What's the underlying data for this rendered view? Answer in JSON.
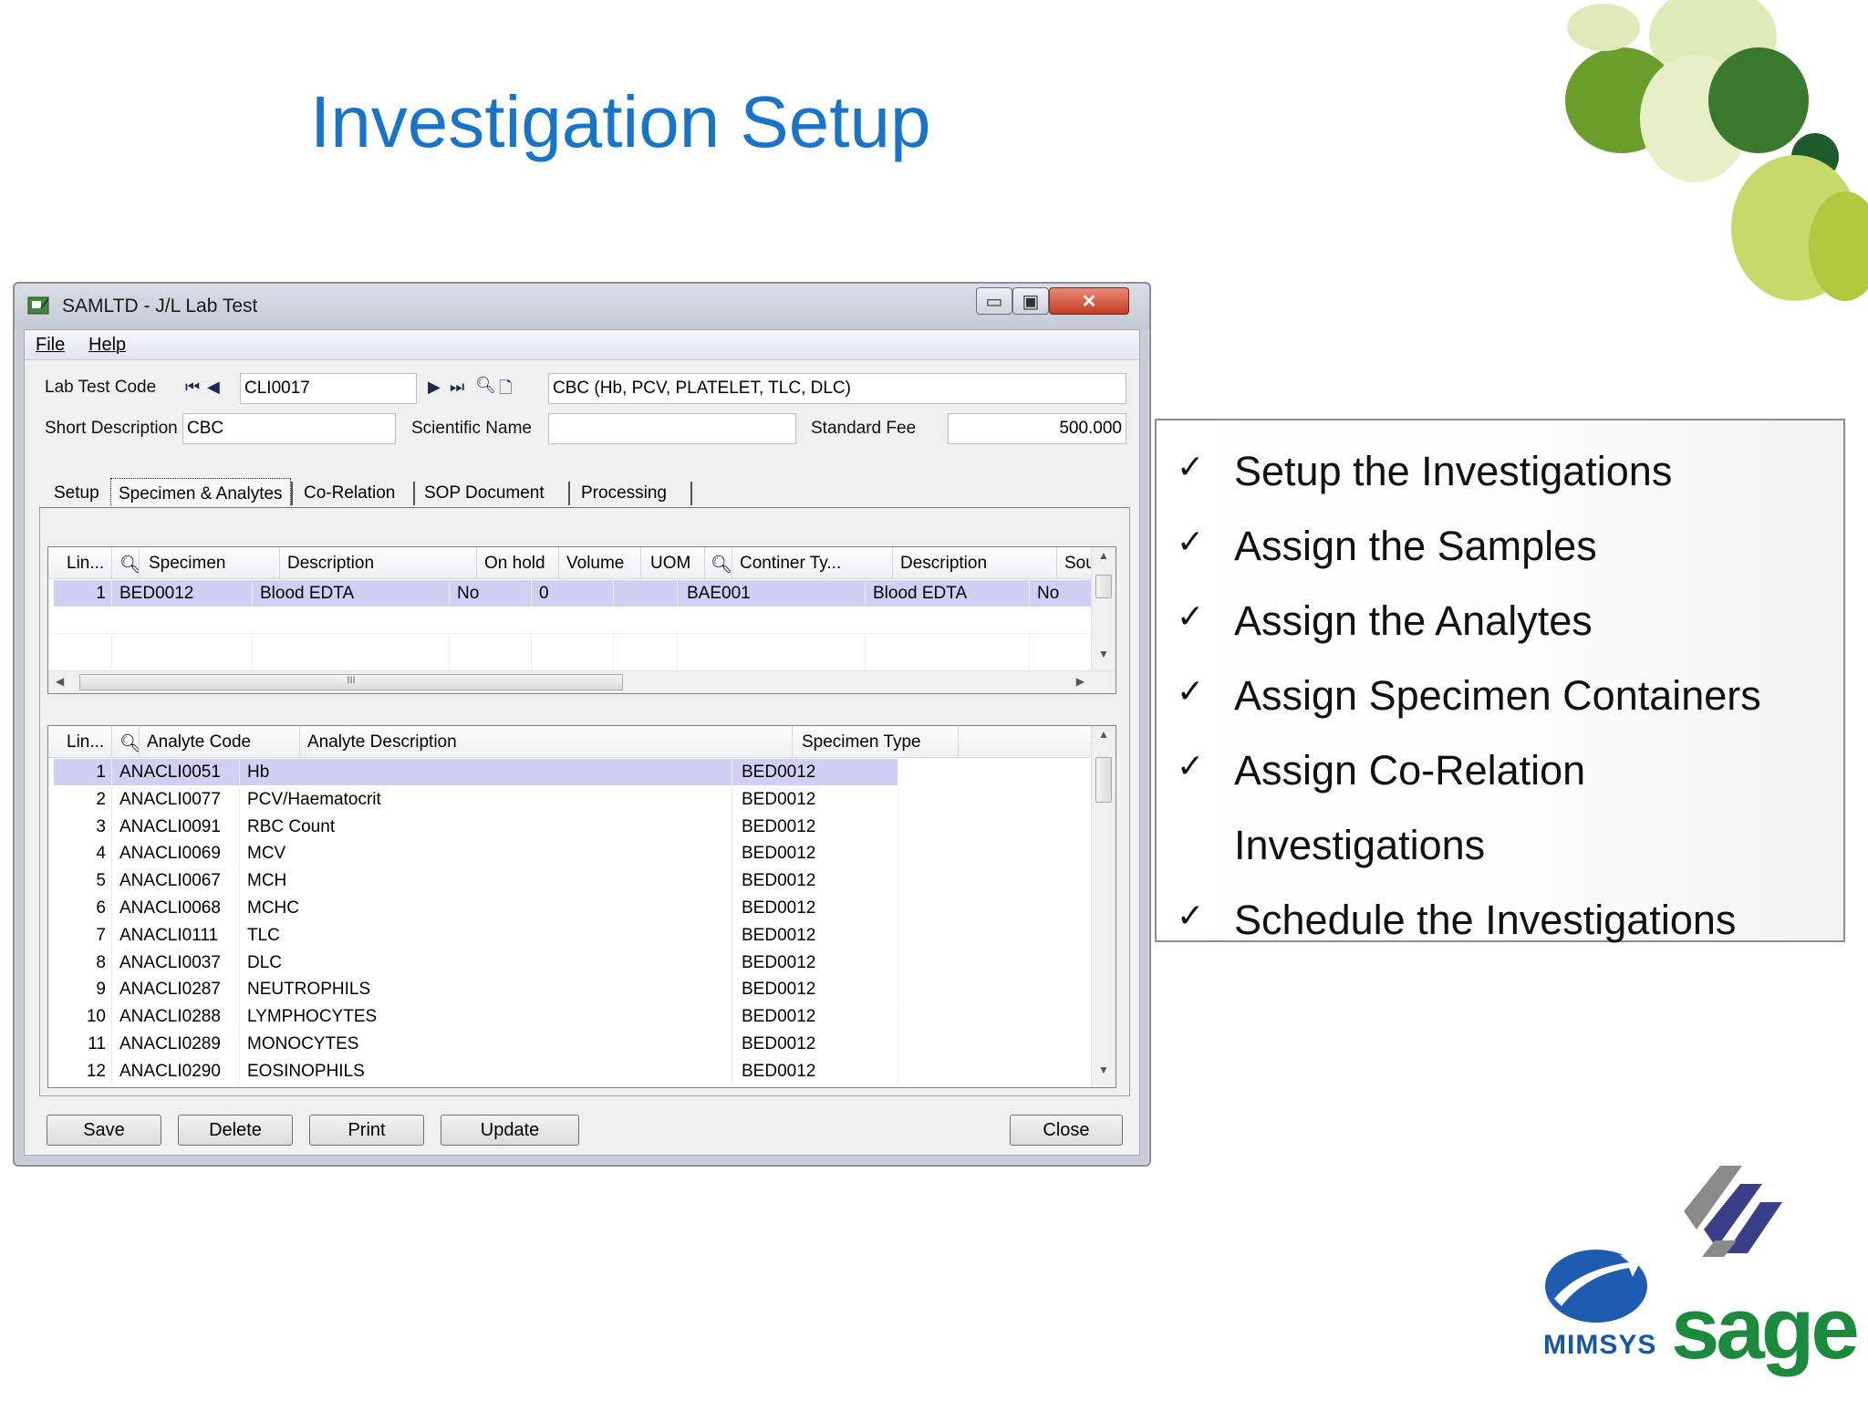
{
  "slide": {
    "title": "Investigation Setup"
  },
  "window": {
    "title": "SAMLTD - J/L Lab Test",
    "menu": [
      "File",
      "Help"
    ]
  },
  "form": {
    "lab_test_code_label": "Lab Test Code",
    "lab_test_code": "CLI0017",
    "long_description": "CBC (Hb, PCV, PLATELET, TLC, DLC)",
    "short_description_label": "Short Description",
    "short_description": "CBC",
    "scientific_name_label": "Scientific Name",
    "scientific_name": "",
    "standard_fee_label": "Standard Fee",
    "standard_fee": "500.000"
  },
  "tabs": [
    "Setup",
    "Specimen & Analytes",
    "Co-Relation",
    "SOP Document",
    "Processing"
  ],
  "specimen_grid": {
    "headers": [
      "Lin...",
      "Specimen",
      "Description",
      "On hold",
      "Volume",
      "UOM",
      "Continer Ty...",
      "Description",
      "Source"
    ],
    "rows": [
      [
        "1",
        "BED0012",
        "Blood EDTA",
        "No",
        "0",
        "",
        "BAE001",
        "Blood EDTA",
        "No"
      ]
    ],
    "hscroll_marker": "III"
  },
  "analyte_grid": {
    "headers": [
      "Lin...",
      "Analyte Code",
      "Analyte Description",
      "Specimen Type"
    ],
    "rows": [
      [
        "1",
        "ANACLI0051",
        "Hb",
        "BED0012"
      ],
      [
        "2",
        "ANACLI0077",
        "PCV/Haematocrit",
        "BED0012"
      ],
      [
        "3",
        "ANACLI0091",
        "RBC Count",
        "BED0012"
      ],
      [
        "4",
        "ANACLI0069",
        "MCV",
        "BED0012"
      ],
      [
        "5",
        "ANACLI0067",
        "MCH",
        "BED0012"
      ],
      [
        "6",
        "ANACLI0068",
        "MCHC",
        "BED0012"
      ],
      [
        "7",
        "ANACLI0111",
        "TLC",
        "BED0012"
      ],
      [
        "8",
        "ANACLI0037",
        "DLC",
        "BED0012"
      ],
      [
        "9",
        "ANACLI0287",
        "NEUTROPHILS",
        "BED0012"
      ],
      [
        "10",
        "ANACLI0288",
        "LYMPHOCYTES",
        "BED0012"
      ],
      [
        "11",
        "ANACLI0289",
        "MONOCYTES",
        "BED0012"
      ],
      [
        "12",
        "ANACLI0290",
        "EOSINOPHILS",
        "BED0012"
      ]
    ]
  },
  "buttons": {
    "save": "Save",
    "delete": "Delete",
    "print": "Print",
    "update": "Update",
    "close": "Close"
  },
  "checklist": [
    "Setup the Investigations",
    "Assign the Samples",
    "Assign the Analytes",
    "Assign Specimen Containers",
    "Assign Co-Relation",
    "Investigations",
    "Schedule the Investigations"
  ],
  "checkmark": "✓",
  "logos": {
    "mimsys": "MIMSYS",
    "sage": "sage"
  },
  "colors": {
    "title_blue": "#1874c8",
    "selected_row": "#cfd0f4",
    "sage_green": "#1b8a3c",
    "mimsys_blue": "#1a55a6"
  }
}
